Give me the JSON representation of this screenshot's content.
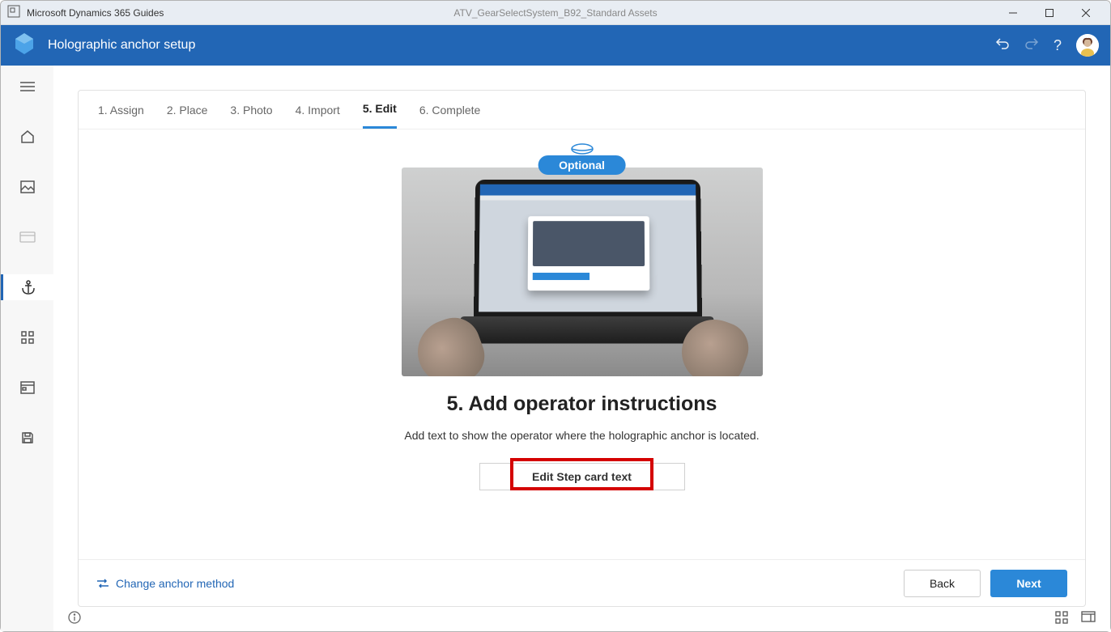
{
  "titlebar": {
    "app_name": "Microsoft Dynamics 365 Guides",
    "document_name": "ATV_GearSelectSystem_B92_Standard Assets"
  },
  "header": {
    "title": "Holographic anchor setup",
    "undo_tooltip": "Undo",
    "redo_tooltip": "Redo",
    "help_tooltip": "Help"
  },
  "sidebar": {
    "items": [
      {
        "name": "menu"
      },
      {
        "name": "home"
      },
      {
        "name": "image"
      },
      {
        "name": "card"
      },
      {
        "name": "anchor",
        "active": true
      },
      {
        "name": "apps"
      },
      {
        "name": "storage"
      },
      {
        "name": "save"
      }
    ]
  },
  "stepper": {
    "items": [
      {
        "label": "1. Assign"
      },
      {
        "label": "2. Place"
      },
      {
        "label": "3. Photo"
      },
      {
        "label": "4. Import"
      },
      {
        "label": "5. Edit",
        "active": true
      },
      {
        "label": "6. Complete"
      }
    ]
  },
  "main": {
    "optional_badge": "Optional",
    "title": "5. Add operator instructions",
    "description": "Add text to show the operator where the holographic anchor is located.",
    "edit_button": "Edit Step card text"
  },
  "footer": {
    "change_anchor": "Change anchor method",
    "back": "Back",
    "next": "Next"
  }
}
